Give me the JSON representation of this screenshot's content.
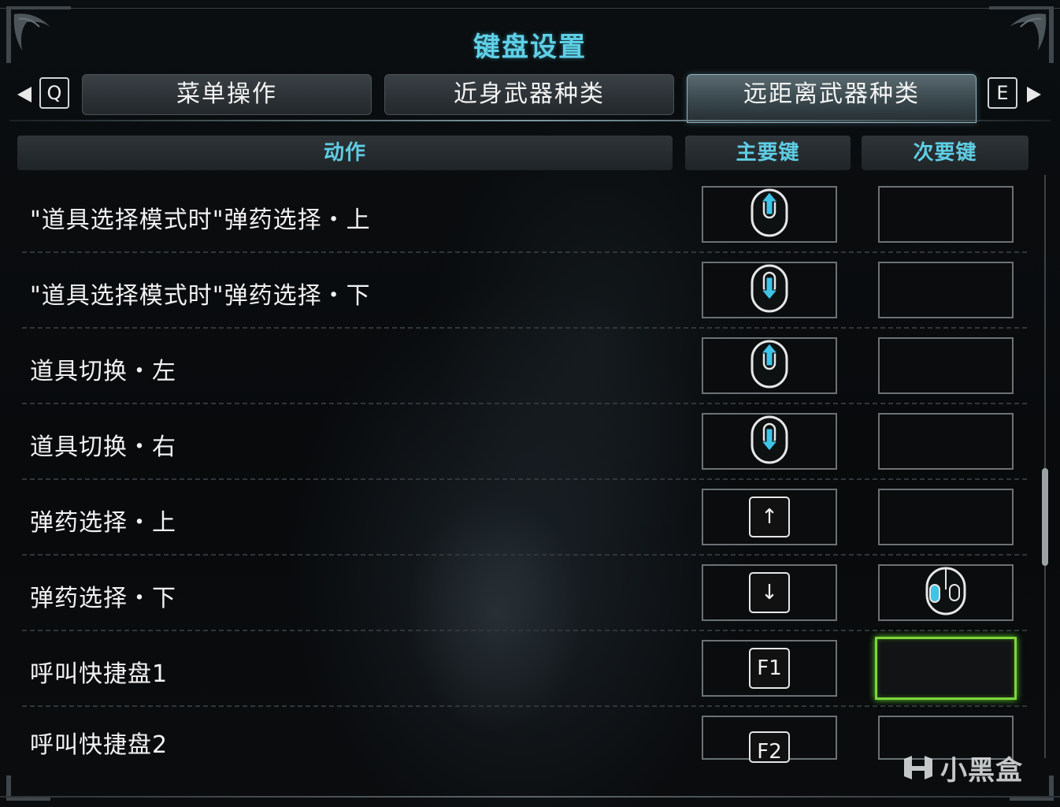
{
  "window": {
    "title": "键盘设置"
  },
  "tabs": {
    "prev_key": "Q",
    "next_key": "E",
    "items": [
      {
        "label": "菜单操作",
        "active": false
      },
      {
        "label": "近身武器种类",
        "active": false
      },
      {
        "label": "远距离武器种类",
        "active": true
      }
    ]
  },
  "columns": {
    "action": "动作",
    "primary": "主要键",
    "secondary": "次要键"
  },
  "rows": [
    {
      "action": "\"道具选择模式时\"弹药选择・上",
      "primary": {
        "icon": "mouse-scroll-up-icon"
      },
      "secondary": {
        "icon": ""
      }
    },
    {
      "action": "\"道具选择模式时\"弹药选择・下",
      "primary": {
        "icon": "mouse-scroll-down-icon"
      },
      "secondary": {
        "icon": ""
      }
    },
    {
      "action": "道具切换・左",
      "primary": {
        "icon": "mouse-scroll-up-icon"
      },
      "secondary": {
        "icon": ""
      }
    },
    {
      "action": "道具切换・右",
      "primary": {
        "icon": "mouse-scroll-down-icon"
      },
      "secondary": {
        "icon": ""
      }
    },
    {
      "action": "弹药选择・上",
      "primary": {
        "icon": "arrow-up-key-icon",
        "key": "↑"
      },
      "secondary": {
        "icon": ""
      }
    },
    {
      "action": "弹药选择・下",
      "primary": {
        "icon": "arrow-down-key-icon",
        "key": "↓"
      },
      "secondary": {
        "icon": "mouse-left-button-icon"
      }
    },
    {
      "action": "呼叫快捷盘1",
      "primary": {
        "key": "F1"
      },
      "secondary": {
        "icon": "",
        "selected": true
      }
    },
    {
      "action": "呼叫快捷盘2",
      "primary": {
        "key": "F2"
      },
      "secondary": {
        "icon": ""
      }
    }
  ],
  "watermark": "小黑盒",
  "colors": {
    "accent": "#5fcde4",
    "selection": "#7dd63a",
    "mouse_highlight": "#3ec4e6"
  }
}
